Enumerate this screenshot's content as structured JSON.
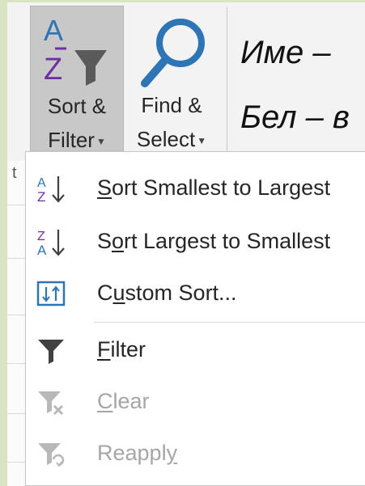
{
  "ribbon": {
    "sort_filter": {
      "line1": "Sort &",
      "line2": "Filter",
      "icon": "sort-az-filter-icon"
    },
    "find_select": {
      "line1": "Find &",
      "line2": "Select",
      "icon": "magnifier-icon"
    },
    "cell_text_1": "Име –",
    "cell_text_2": "Бел – в"
  },
  "grid": {
    "left_fragment": "t"
  },
  "menu": {
    "items": [
      {
        "pre": "",
        "accel": "S",
        "post": "ort Smallest to Largest",
        "icon": "sort-ascending-icon",
        "disabled": false
      },
      {
        "pre": "S",
        "accel": "o",
        "post": "rt Largest to Smallest",
        "icon": "sort-descending-icon",
        "disabled": false
      },
      {
        "pre": "C",
        "accel": "u",
        "post": "stom Sort...",
        "icon": "custom-sort-icon",
        "disabled": false
      },
      {
        "pre": "",
        "accel": "F",
        "post": "ilter",
        "icon": "filter-icon",
        "disabled": false
      },
      {
        "pre": "",
        "accel": "C",
        "post": "lear",
        "icon": "clear-filter-icon",
        "disabled": true
      },
      {
        "pre": "Reappl",
        "accel": "y",
        "post": "",
        "icon": "reapply-filter-icon",
        "disabled": true
      }
    ]
  },
  "colors": {
    "accent_blue": "#2e75b6",
    "accent_purple": "#7030a0",
    "disabled_gray": "#a6a6a6"
  }
}
